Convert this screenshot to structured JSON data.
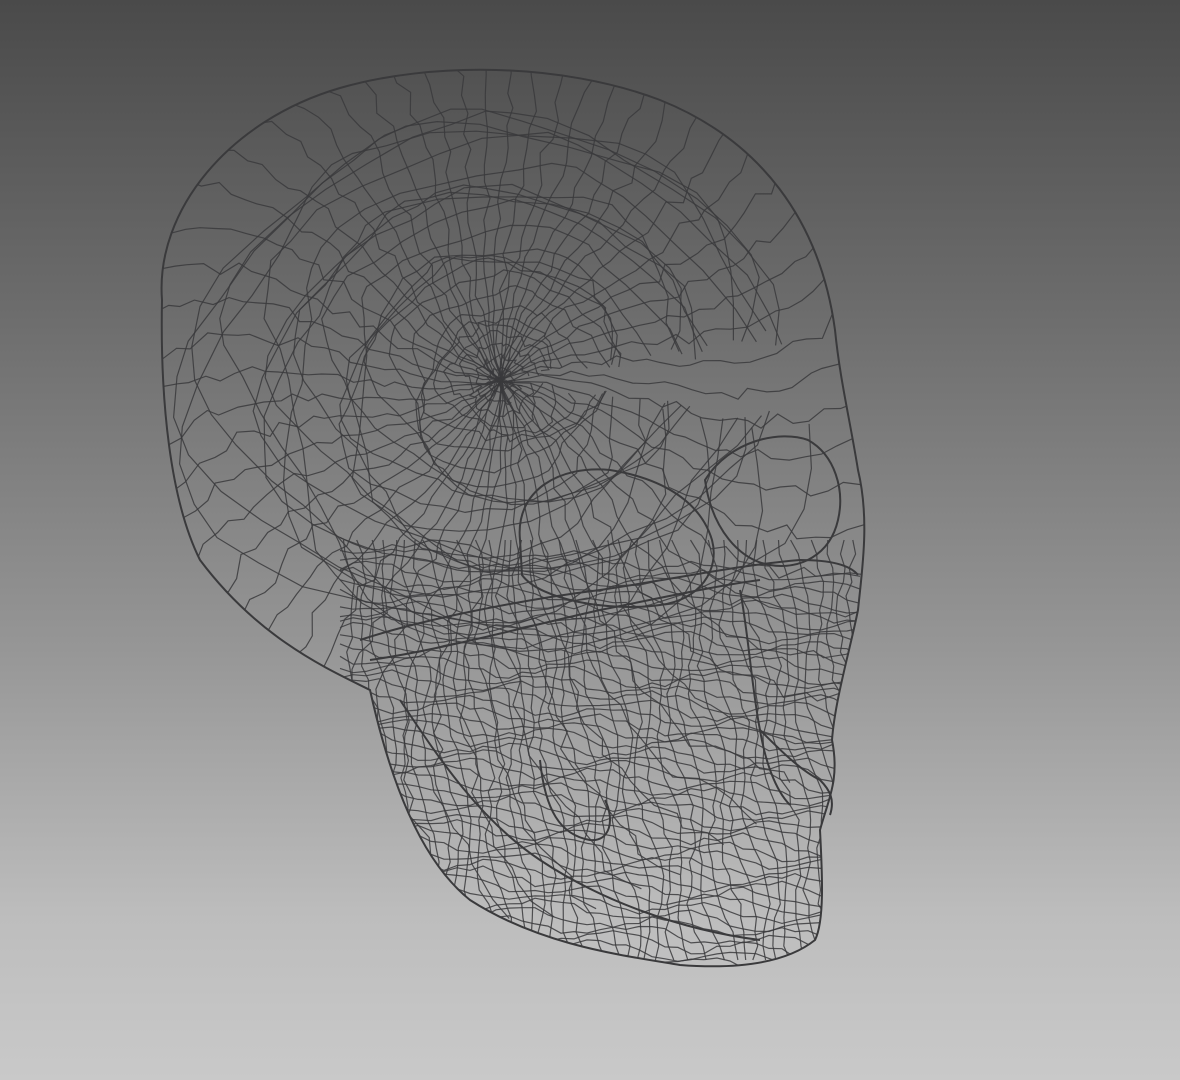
{
  "viewport": {
    "background_top": "#4a4a4a",
    "background_bottom": "#c9c9c9"
  },
  "model": {
    "subject": "human skull",
    "render_mode": "wireframe",
    "wire_color": "#3a3a3c"
  }
}
